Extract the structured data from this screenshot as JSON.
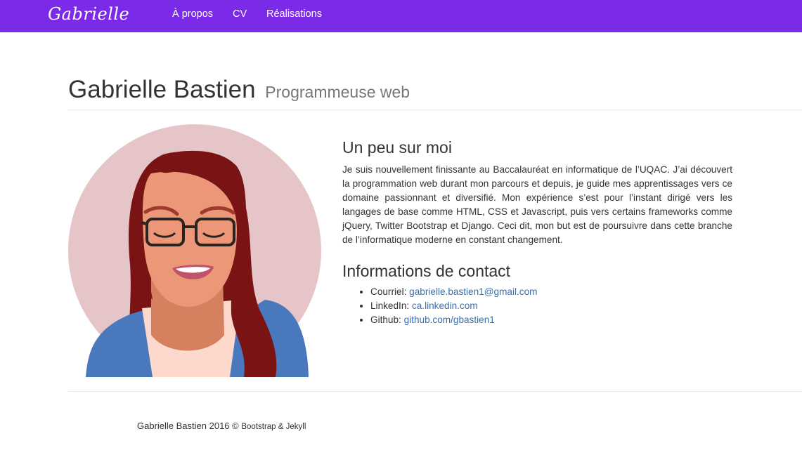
{
  "nav": {
    "brand": "Gabrielle",
    "links": [
      "À propos",
      "CV",
      "Réalisations"
    ]
  },
  "header": {
    "name": "Gabrielle Bastien",
    "subtitle": "Programmeuse web"
  },
  "about": {
    "title": "Un peu sur moi",
    "text": "Je suis nouvellement finissante au Baccalauréat en informatique de l’UQAC. J’ai découvert la programmation web durant mon parcours et depuis, je guide mes apprentissages vers ce domaine passionnant et diversifié. Mon expérience s’est pour l’instant dirigé vers les langages de base comme HTML, CSS et Javascript, puis vers certains frameworks comme jQuery, Twitter Bootstrap et Django. Ceci dit, mon but est de poursuivre dans cette branche de l’informatique moderne en constant changement."
  },
  "contact": {
    "title": "Informations de contact",
    "items": [
      {
        "label": "Courriel:",
        "value": "gabrielle.bastien1@gmail.com"
      },
      {
        "label": "LinkedIn:",
        "value": "ca.linkedin.com"
      },
      {
        "label": "Github:",
        "value": "github.com/gbastien1"
      }
    ]
  },
  "footer": {
    "copyright": "Gabrielle Bastien 2016 ©",
    "credits": "Bootstrap & Jekyll"
  },
  "colors": {
    "navbar": "#7b2be8",
    "link": "#3a6fb0",
    "avatar_bg": "#e5c5c7",
    "hair": "#7a1414",
    "skin": "#ec9878",
    "shirt": "#4a78bd"
  },
  "icons": {
    "avatar": "portrait-illustration"
  }
}
